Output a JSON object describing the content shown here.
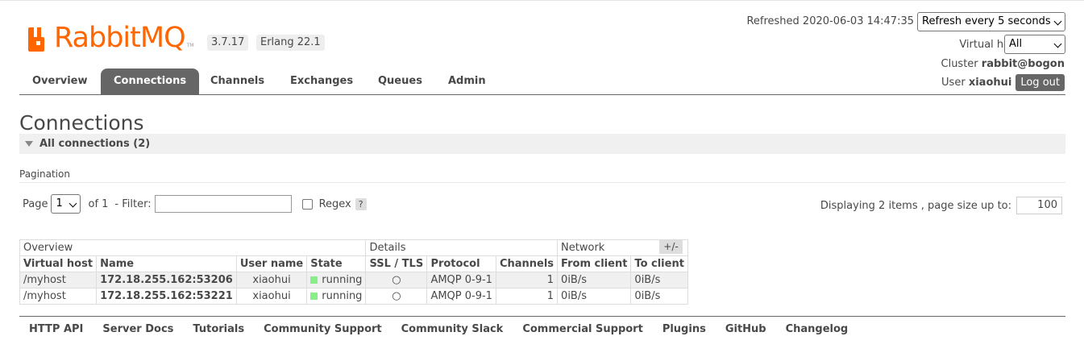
{
  "app": {
    "brand": "RabbitMQ",
    "brand_tm": "TM",
    "version": "3.7.17",
    "erlang": "Erlang 22.1",
    "colors": {
      "brand": "#ff6600",
      "nav_active": "#666666",
      "running": "#88ee88"
    }
  },
  "header": {
    "refreshed": "Refreshed 2020-06-03 14:47:35",
    "refresh_option": "Refresh every 5 seconds",
    "vhost_label": "Virtual host",
    "vhost_value": "All",
    "cluster_label": "Cluster",
    "cluster_value": "rabbit@bogon",
    "user_label": "User",
    "user_value": "xiaohui",
    "logout": "Log out"
  },
  "nav": {
    "tabs": [
      {
        "label": "Overview"
      },
      {
        "label": "Connections"
      },
      {
        "label": "Channels"
      },
      {
        "label": "Exchanges"
      },
      {
        "label": "Queues"
      },
      {
        "label": "Admin"
      }
    ],
    "active": "Connections"
  },
  "page": {
    "title": "Connections",
    "section": "All connections (2)",
    "pagination_title": "Pagination",
    "page_label": "Page",
    "page_value": "1",
    "of_label": "of 1",
    "filter_label": "- Filter:",
    "filter_value": "",
    "regex_label": "Regex",
    "help": "?",
    "displaying": "Displaying 2 items , page size up to:",
    "page_size": "100"
  },
  "table": {
    "groups": [
      "Overview",
      "Details",
      "Network"
    ],
    "toggle": "+/-",
    "columns": [
      "Virtual host",
      "Name",
      "User name",
      "State",
      "SSL / TLS",
      "Protocol",
      "Channels",
      "From client",
      "To client"
    ],
    "rows": [
      {
        "vhost": "/myhost",
        "name": "172.18.255.162:53206",
        "user": "xiaohui",
        "state": "running",
        "ssl": "○",
        "protocol": "AMQP 0-9-1",
        "channels": "1",
        "from": "0iB/s",
        "to": "0iB/s"
      },
      {
        "vhost": "/myhost",
        "name": "172.18.255.162:53221",
        "user": "xiaohui",
        "state": "running",
        "ssl": "○",
        "protocol": "AMQP 0-9-1",
        "channels": "1",
        "from": "0iB/s",
        "to": "0iB/s"
      }
    ]
  },
  "footer": {
    "links": [
      "HTTP API",
      "Server Docs",
      "Tutorials",
      "Community Support",
      "Community Slack",
      "Commercial Support",
      "Plugins",
      "GitHub",
      "Changelog"
    ]
  }
}
